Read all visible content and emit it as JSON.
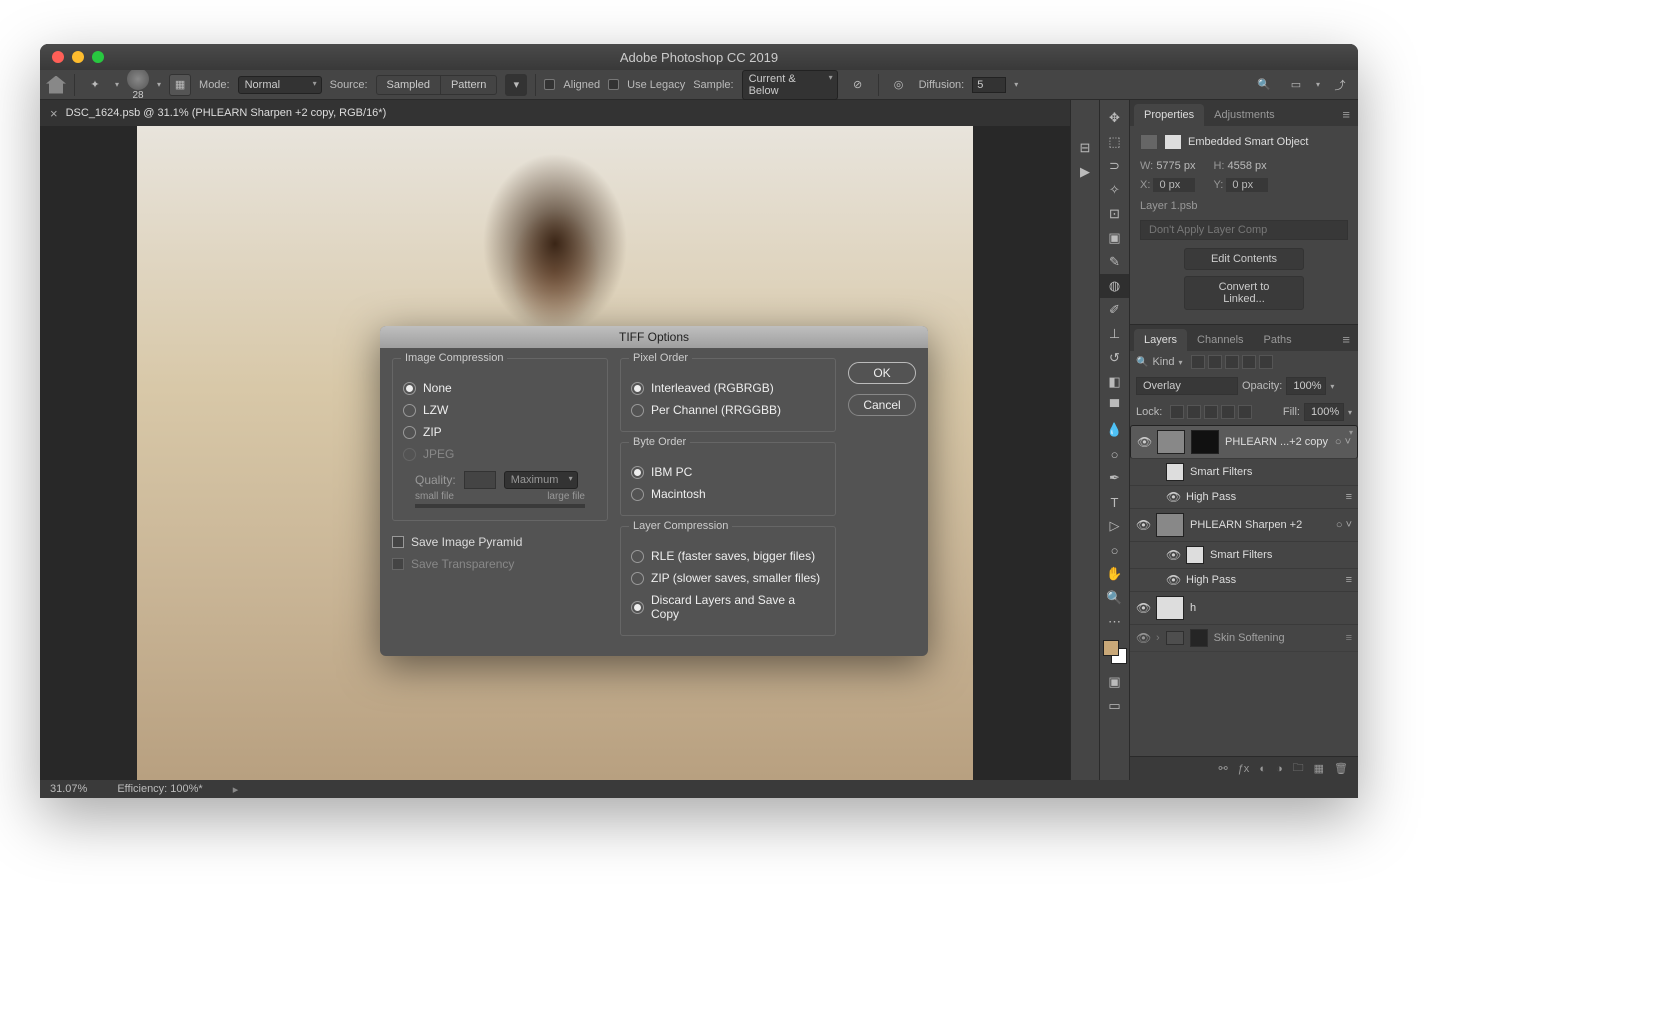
{
  "app": {
    "title": "Adobe Photoshop CC 2019"
  },
  "optionsBar": {
    "brushSize": "28",
    "modeLabel": "Mode:",
    "mode": "Normal",
    "sourceLabel": "Source:",
    "sampled": "Sampled",
    "pattern": "Pattern",
    "aligned": "Aligned",
    "useLegacy": "Use Legacy",
    "sampleLabel": "Sample:",
    "sample": "Current & Below",
    "diffusionLabel": "Diffusion:",
    "diffusion": "5"
  },
  "docTab": {
    "title": "DSC_1624.psb @ 31.1% (PHLEARN Sharpen +2 copy, RGB/16*)"
  },
  "status": {
    "zoom": "31.07%",
    "efficiency": "Efficiency: 100%*"
  },
  "propertiesPanel": {
    "tabProperties": "Properties",
    "tabAdjustments": "Adjustments",
    "header": "Embedded Smart Object",
    "wLabel": "W:",
    "w": "5775 px",
    "hLabel": "H:",
    "h": "4558 px",
    "xLabel": "X:",
    "x": "0 px",
    "yLabel": "Y:",
    "y": "0 px",
    "layerFile": "Layer 1.psb",
    "layerCompSelect": "Don't Apply Layer Comp",
    "editContents": "Edit Contents",
    "convertLinked": "Convert to Linked..."
  },
  "layersPanel": {
    "tabLayers": "Layers",
    "tabChannels": "Channels",
    "tabPaths": "Paths",
    "kind": "Kind",
    "blend": "Overlay",
    "opacityLabel": "Opacity:",
    "opacity": "100%",
    "lockLabel": "Lock:",
    "fillLabel": "Fill:",
    "fill": "100%",
    "layers": [
      {
        "name": "PHLEARN ...+2 copy",
        "selected": true,
        "smartFilters": "Smart Filters",
        "filter": "High Pass"
      },
      {
        "name": "PHLEARN Sharpen +2",
        "selected": false,
        "smartFilters": "Smart Filters",
        "filter": "High Pass"
      },
      {
        "name": "h",
        "selected": false
      },
      {
        "name": "Skin Softening",
        "selected": false
      }
    ]
  },
  "dialog": {
    "title": "TIFF Options",
    "ok": "OK",
    "cancel": "Cancel",
    "imageCompression": {
      "title": "Image Compression",
      "none": "None",
      "lzw": "LZW",
      "zip": "ZIP",
      "jpeg": "JPEG",
      "qualityLabel": "Quality:",
      "qualityPreset": "Maximum",
      "smallFile": "small file",
      "largeFile": "large file"
    },
    "saveImagePyramid": "Save Image Pyramid",
    "saveTransparency": "Save Transparency",
    "pixelOrder": {
      "title": "Pixel Order",
      "interleaved": "Interleaved (RGBRGB)",
      "perChannel": "Per Channel (RRGGBB)"
    },
    "byteOrder": {
      "title": "Byte Order",
      "ibm": "IBM PC",
      "mac": "Macintosh"
    },
    "layerCompression": {
      "title": "Layer Compression",
      "rle": "RLE (faster saves, bigger files)",
      "zip": "ZIP (slower saves, smaller files)",
      "discard": "Discard Layers and Save a Copy"
    }
  }
}
